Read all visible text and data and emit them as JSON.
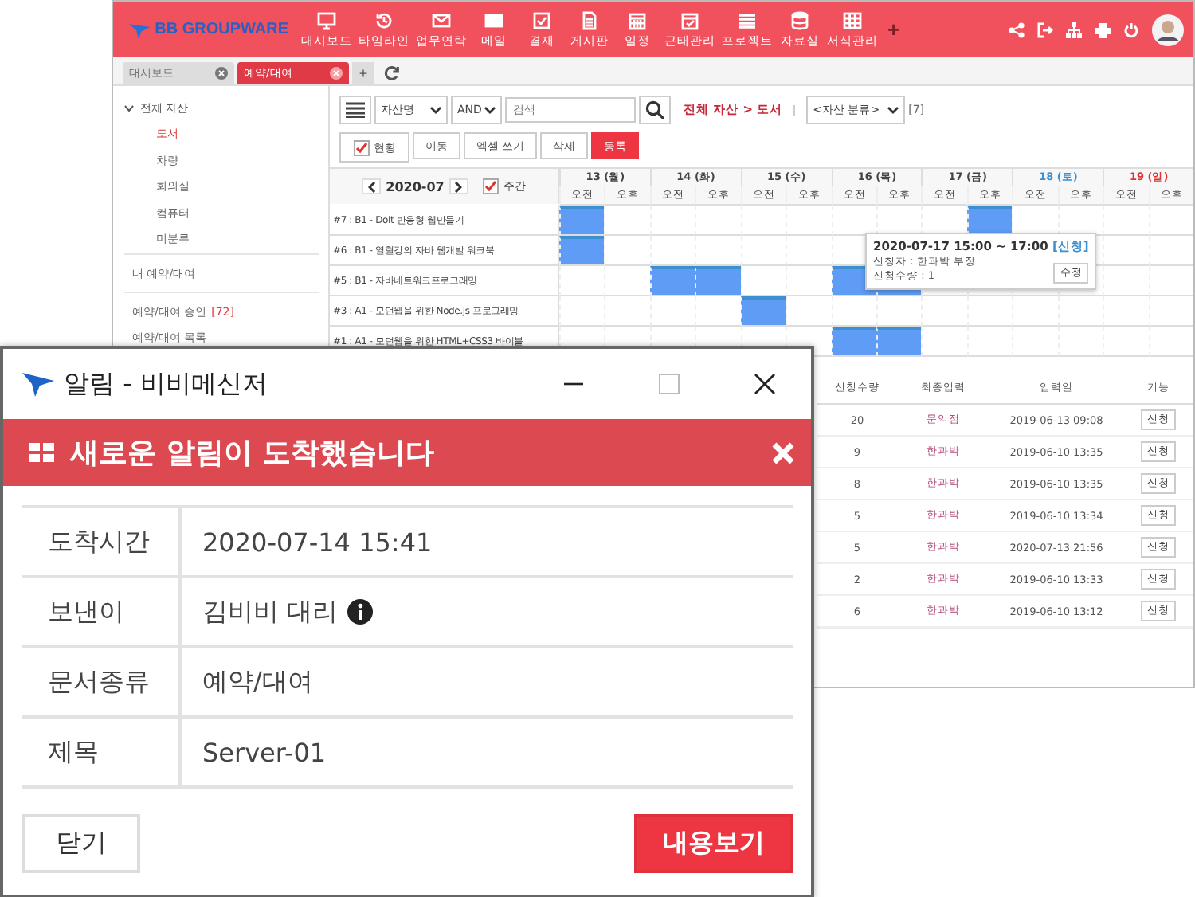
{
  "header": {
    "logo": "BB GROUPWARE",
    "nav": [
      {
        "label": "대시보드"
      },
      {
        "label": "타임라인"
      },
      {
        "label": "업무연락"
      },
      {
        "label": "메일"
      },
      {
        "label": "결재"
      },
      {
        "label": "게시판"
      },
      {
        "label": "일정"
      },
      {
        "label": "근태관리"
      },
      {
        "label": "프로젝트"
      },
      {
        "label": "자료실"
      },
      {
        "label": "서식관리"
      }
    ],
    "add": "+"
  },
  "tabs": [
    {
      "label": "대시보드",
      "selected": false
    },
    {
      "label": "예약/대여",
      "selected": true
    }
  ],
  "tab_add": "+",
  "sidebar": {
    "tree": [
      {
        "label": "전체 자산",
        "expanded": true,
        "children": [
          {
            "label": "도서",
            "selected": true
          },
          {
            "label": "차량",
            "selected": false
          },
          {
            "label": "회의실",
            "selected": false
          },
          {
            "label": "컴퓨터",
            "selected": false
          },
          {
            "label": "미분류",
            "selected": false
          }
        ]
      }
    ],
    "items": [
      {
        "label": "내 예약/대여"
      },
      {
        "label": "예약/대여 승인",
        "count": "[72]"
      },
      {
        "label": "예약/대여 목록"
      }
    ]
  },
  "toolbar": {
    "field_select": "자산명",
    "logic_select": "AND",
    "search": {
      "placeholder": "검색"
    },
    "breadcrumb": "전체 자산 > 도서",
    "category_select": "<자산 분류>",
    "count": "[7]",
    "status_check": {
      "label": "현황",
      "checked": true
    },
    "buttons": [
      {
        "label": "이동",
        "kind": "default"
      },
      {
        "label": "엑셀 쓰기",
        "kind": "default"
      },
      {
        "label": "삭제",
        "kind": "default"
      },
      {
        "label": "등록",
        "kind": "primary"
      }
    ]
  },
  "calendar": {
    "month": "2020-07",
    "weekly": {
      "label": "주간",
      "checked": true
    },
    "days": [
      {
        "label": "13 (월)",
        "kind": "weekday",
        "halves": [
          "오전",
          "오후"
        ]
      },
      {
        "label": "14 (화)",
        "kind": "weekday",
        "halves": [
          "오전",
          "오후"
        ]
      },
      {
        "label": "15 (수)",
        "kind": "weekday",
        "halves": [
          "오전",
          "오후"
        ]
      },
      {
        "label": "16 (목)",
        "kind": "weekday",
        "halves": [
          "오전",
          "오후"
        ]
      },
      {
        "label": "17 (금)",
        "kind": "weekday",
        "halves": [
          "오전",
          "오후"
        ]
      },
      {
        "label": "18 (토)",
        "kind": "saturday",
        "halves": [
          "오전",
          "오후"
        ]
      },
      {
        "label": "19 (일)",
        "kind": "sunday",
        "halves": [
          "오전",
          "오후"
        ]
      }
    ],
    "rows": [
      {
        "label": "#7 : B1 - DoIt 반응형 웹만들기",
        "slots": [
          true,
          false,
          false,
          false,
          false,
          false,
          false,
          false,
          false,
          true,
          false,
          false,
          false,
          false
        ]
      },
      {
        "label": "#6 : B1 - 열혈강의 자바 웹개발 워크북",
        "slots": [
          true,
          false,
          false,
          false,
          false,
          false,
          false,
          false,
          false,
          false,
          false,
          false,
          false,
          false
        ]
      },
      {
        "label": "#5 : B1 - 자바네트워크프로그래밍",
        "slots": [
          false,
          false,
          true,
          true,
          false,
          false,
          true,
          true,
          false,
          false,
          false,
          false,
          false,
          false
        ]
      },
      {
        "label": "#3 : A1 - 모던웹을 위한 Node.js 프로그래밍",
        "slots": [
          false,
          false,
          false,
          false,
          true,
          false,
          false,
          false,
          false,
          false,
          false,
          false,
          false,
          false
        ]
      },
      {
        "label": "#1 : A1 - 모던웹을 위한 HTML+CSS3 바이블",
        "slots": [
          false,
          false,
          false,
          false,
          false,
          false,
          true,
          true,
          false,
          false,
          false,
          false,
          false,
          false
        ]
      }
    ],
    "tooltip": {
      "time": "2020-07-17 15:00 ~ 17:00",
      "status": "[신청]",
      "applicant": "신청자 : 한과박 부장",
      "quantity": "신청수량 : 1",
      "button": "수정"
    }
  },
  "table": {
    "columns": [
      "신청수량",
      "최종입력",
      "입력일",
      "기능"
    ],
    "rows": [
      {
        "quantity": "20",
        "last_editor": "문익점",
        "date": "2019-06-13 09:08",
        "action": "신청"
      },
      {
        "quantity": "9",
        "last_editor": "한과박",
        "date": "2019-06-10 13:35",
        "action": "신청"
      },
      {
        "quantity": "8",
        "last_editor": "한과박",
        "date": "2019-06-10 13:35",
        "action": "신청"
      },
      {
        "quantity": "5",
        "last_editor": "한과박",
        "date": "2019-06-10 13:34",
        "action": "신청"
      },
      {
        "quantity": "5",
        "last_editor": "한과박",
        "date": "2020-07-13 21:56",
        "action": "신청"
      },
      {
        "quantity": "2",
        "last_editor": "한과박",
        "date": "2019-06-10 13:33",
        "action": "신청"
      },
      {
        "quantity": "6",
        "last_editor": "한과박",
        "date": "2019-06-10 13:12",
        "action": "신청"
      }
    ]
  },
  "popup": {
    "title": "알림 - 비비메신저",
    "banner": "새로운 알림이 도착했습니다",
    "fields": [
      {
        "label": "도착시간",
        "value": "2020-07-14 15:41",
        "info": false
      },
      {
        "label": "보낸이",
        "value": "김비비 대리",
        "info": true
      },
      {
        "label": "문서종류",
        "value": "예약/대여",
        "info": false
      },
      {
        "label": "제목",
        "value": "Server-01",
        "info": false
      }
    ],
    "buttons": [
      {
        "label": "닫기",
        "kind": "default"
      },
      {
        "label": "내용보기",
        "kind": "primary"
      }
    ]
  }
}
